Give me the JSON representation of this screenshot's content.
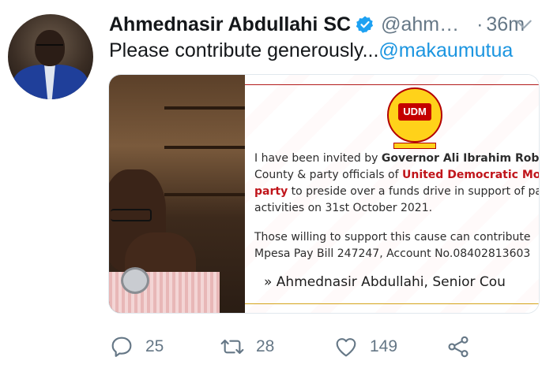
{
  "tweet": {
    "display_name": "Ahmednasir Abdullahi SC",
    "handle": "@ahm…",
    "separator": "·",
    "time": "36m",
    "text": "Please contribute generously...",
    "mention": "@makaumutua"
  },
  "poster": {
    "logo_text": "UDM",
    "line1_prefix": "I have been invited by ",
    "line1_bold": "Governor Ali Ibrahim Roba",
    "line2_prefix": "County & party officials of ",
    "line2_red": "United Democratic Mov",
    "line3_red": "party",
    "line3_rest": " to preside over a funds drive in support of pa",
    "line4": "activities on 31st October 2021.",
    "line5": "Those willing to support this cause can  contribute",
    "line6": "Mpesa Pay Bill 247247, Account No.08402813603",
    "signature": "» Ahmednasir Abdullahi, Senior Cou"
  },
  "actions": {
    "reply_count": "25",
    "retweet_count": "28",
    "like_count": "149"
  },
  "colors": {
    "link": "#1b95e0",
    "muted": "#657786",
    "verified": "#1da1f2",
    "udm_red": "#c0151b"
  }
}
